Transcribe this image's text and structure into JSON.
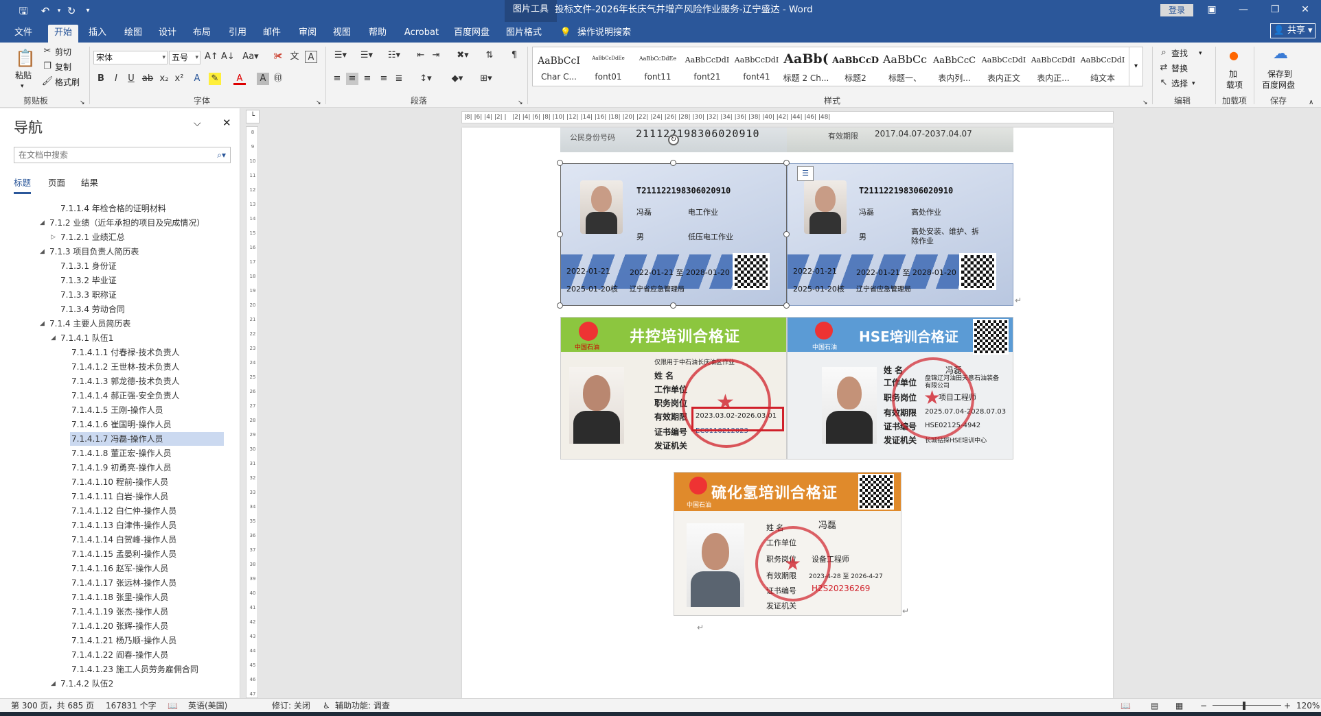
{
  "titlebar": {
    "context_tools": "图片工具",
    "document_title": "投标文件-2026年长庆气井增产风险作业服务-辽宁盛达  -  Word",
    "login": "登录"
  },
  "tabs": [
    "文件",
    "开始",
    "插入",
    "绘图",
    "设计",
    "布局",
    "引用",
    "邮件",
    "审阅",
    "视图",
    "帮助",
    "Acrobat",
    "百度网盘",
    "图片格式"
  ],
  "tell_me": "操作说明搜索",
  "share": "共享",
  "ribbon": {
    "clipboard": {
      "paste": "粘贴",
      "cut": "剪切",
      "copy": "复制",
      "format_painter": "格式刷",
      "label": "剪贴板"
    },
    "font": {
      "font_name": "宋体",
      "font_size": "五号",
      "label": "字体"
    },
    "paragraph": {
      "label": "段落"
    },
    "styles": {
      "label": "样式",
      "items": [
        {
          "preview": "AaBbCcI",
          "name": "Char C..."
        },
        {
          "preview": "AaBbCcDdEe",
          "name": "font01"
        },
        {
          "preview": "AaBbCcDdEe",
          "name": "font11"
        },
        {
          "preview": "AaBbCcDdI",
          "name": "font21"
        },
        {
          "preview": "AaBbCcDdI",
          "name": "font41"
        },
        {
          "preview": "AaBb(",
          "name": "标题 2 Ch..."
        },
        {
          "preview": "AaBbCcD",
          "name": "标题2"
        },
        {
          "preview": "AaBbCc",
          "name": "标题一、"
        },
        {
          "preview": "AaBbCcC",
          "name": "表内列..."
        },
        {
          "preview": "AaBbCcDdI",
          "name": "表内正文"
        },
        {
          "preview": "AaBbCcDdI",
          "name": "表内正..."
        },
        {
          "preview": "AaBbCcDdI",
          "name": "纯文本"
        }
      ]
    },
    "editing": {
      "find": "查找",
      "replace": "替换",
      "select": "选择",
      "label": "编辑"
    },
    "addins": {
      "label_top": "加",
      "label_mid": "载项",
      "label": "加载项"
    },
    "save": {
      "label_1": "保存到",
      "label_2": "百度网盘",
      "label": "保存"
    }
  },
  "nav": {
    "title": "导航",
    "search_placeholder": "在文档中搜索",
    "tabs": [
      "标题",
      "页面",
      "结果"
    ],
    "items": [
      {
        "text": "7.1.1.4 年检合格的证明材料",
        "level": 3,
        "tri": ""
      },
      {
        "text": "7.1.2 业绩（近年承担的项目及完成情况）",
        "level": 2,
        "tri": "open"
      },
      {
        "text": "7.1.2.1 业绩汇总",
        "level": 3,
        "tri": "closed"
      },
      {
        "text": "7.1.3 项目负责人简历表",
        "level": 2,
        "tri": "open"
      },
      {
        "text": "7.1.3.1 身份证",
        "level": 3,
        "tri": ""
      },
      {
        "text": "7.1.3.2 毕业证",
        "level": 3,
        "tri": ""
      },
      {
        "text": "7.1.3.3 职称证",
        "level": 3,
        "tri": ""
      },
      {
        "text": "7.1.3.4 劳动合同",
        "level": 3,
        "tri": ""
      },
      {
        "text": "7.1.4 主要人员简历表",
        "level": 2,
        "tri": "open"
      },
      {
        "text": "7.1.4.1 队伍1",
        "level": 3,
        "tri": "open"
      },
      {
        "text": "7.1.4.1.1 付春禄-技术负责人",
        "level": 4,
        "tri": ""
      },
      {
        "text": "7.1.4.1.2 王世林-技术负责人",
        "level": 4,
        "tri": ""
      },
      {
        "text": "7.1.4.1.3 郭龙德-技术负责人",
        "level": 4,
        "tri": ""
      },
      {
        "text": "7.1.4.1.4 郝正强-安全负责人",
        "level": 4,
        "tri": ""
      },
      {
        "text": "7.1.4.1.5 王刚-操作人员",
        "level": 4,
        "tri": ""
      },
      {
        "text": "7.1.4.1.6 崔国明-操作人员",
        "level": 4,
        "tri": ""
      },
      {
        "text": "7.1.4.1.7 冯磊-操作人员",
        "level": 4,
        "tri": "",
        "selected": true
      },
      {
        "text": "7.1.4.1.8 董正宏-操作人员",
        "level": 4,
        "tri": ""
      },
      {
        "text": "7.1.4.1.9 初勇亮-操作人员",
        "level": 4,
        "tri": ""
      },
      {
        "text": "7.1.4.1.10 程前-操作人员",
        "level": 4,
        "tri": ""
      },
      {
        "text": "7.1.4.1.11 白岩-操作人员",
        "level": 4,
        "tri": ""
      },
      {
        "text": "7.1.4.1.12 白仁仲-操作人员",
        "level": 4,
        "tri": ""
      },
      {
        "text": "7.1.4.1.13 白津伟-操作人员",
        "level": 4,
        "tri": ""
      },
      {
        "text": "7.1.4.1.14 白贺峰-操作人员",
        "level": 4,
        "tri": ""
      },
      {
        "text": "7.1.4.1.15 孟晏利-操作人员",
        "level": 4,
        "tri": ""
      },
      {
        "text": "7.1.4.1.16 赵军-操作人员",
        "level": 4,
        "tri": ""
      },
      {
        "text": "7.1.4.1.17 张远林-操作人员",
        "level": 4,
        "tri": ""
      },
      {
        "text": "7.1.4.1.18 张里-操作人员",
        "level": 4,
        "tri": ""
      },
      {
        "text": "7.1.4.1.19 张杰-操作人员",
        "level": 4,
        "tri": ""
      },
      {
        "text": "7.1.4.1.20 张辉-操作人员",
        "level": 4,
        "tri": ""
      },
      {
        "text": "7.1.4.1.21 杨乃顺-操作人员",
        "level": 4,
        "tri": ""
      },
      {
        "text": "7.1.4.1.22 阎春-操作人员",
        "level": 4,
        "tri": ""
      },
      {
        "text": "7.1.4.1.23 施工人员劳务雇佣合同",
        "level": 4,
        "tri": ""
      },
      {
        "text": "7.1.4.2 队伍2",
        "level": 3,
        "tri": "open"
      }
    ]
  },
  "document": {
    "id_strip": {
      "label_id": "公民身份号码",
      "id_number": "211122198306020910",
      "label_valid": "有效期限",
      "valid": "2017.04.07-2037.04.07"
    },
    "op_card_1": {
      "cert_no": "T211122198306020910",
      "name": "冯磊",
      "category": "电工作业",
      "sex": "男",
      "item": "低压电工作业",
      "first_date": "2022-01-21",
      "valid": "2022-01-21 至 2028-01-20",
      "review": "2025-01-20核",
      "issuer": "辽宁省应急管理局"
    },
    "op_card_2": {
      "cert_no": "T211122198306020910",
      "name": "冯磊",
      "category": "高处作业",
      "sex": "男",
      "item": "高处安装、维护、拆除作业",
      "first_date": "2022-01-21",
      "valid": "2022-01-21 至 2028-01-20",
      "review": "2025-01-20核",
      "issuer": "辽宁省应急管理局"
    },
    "well_card": {
      "title": "井控培训合格证",
      "org": "中国石油",
      "note": "仅限用于中石油长庆油区作业",
      "label_name": "姓    名",
      "label_unit": "工作单位",
      "label_post": "职务岗位",
      "label_valid": "有效期限",
      "valid": "2023.03.02-2026.03.01",
      "label_certno": "证书编号",
      "certno": "EC0110212023",
      "label_issuer": "发证机关"
    },
    "hse_card": {
      "title": "HSE培训合格证",
      "org": "中国石油",
      "label_name": "姓    名",
      "name": "冯磊",
      "label_unit": "工作单位",
      "unit": "盘锦辽河油田天意石油装备有限公司",
      "label_post": "职务岗位",
      "post": "项目工程师",
      "label_valid": "有效期限",
      "valid": "2025.07.04-2028.07.03",
      "label_certno": "证书编号",
      "certno": "HSE02125-4942",
      "label_issuer": "发证机关",
      "issuer": "长城钻探HSE培训中心"
    },
    "h2s_card": {
      "title": "硫化氢培训合格证",
      "org": "中国石油",
      "label_name": "姓    名",
      "name": "冯磊",
      "label_unit": "工作单位",
      "label_post": "职务岗位",
      "post": "设备工程师",
      "label_valid": "有效期限",
      "valid": "2023-4-28 至 2026-4-27",
      "label_certno": "证书编号",
      "certno": "H2S20236269",
      "label_issuer": "发证机关"
    }
  },
  "status": {
    "page": "第 300 页，共 685 页",
    "words": "167831 个字",
    "language": "英语(美国)",
    "track": "修订: 关闭",
    "accessibility": "辅助功能: 调查",
    "zoom": "120%"
  },
  "colors": {
    "title_blue": "#2b579a",
    "card_blue": "#c9d6ea",
    "stamp_red": "#d0202a",
    "green_header": "#8cc63f",
    "orange_header": "#e08a2b",
    "hse_blue": "#5b9bd5"
  }
}
